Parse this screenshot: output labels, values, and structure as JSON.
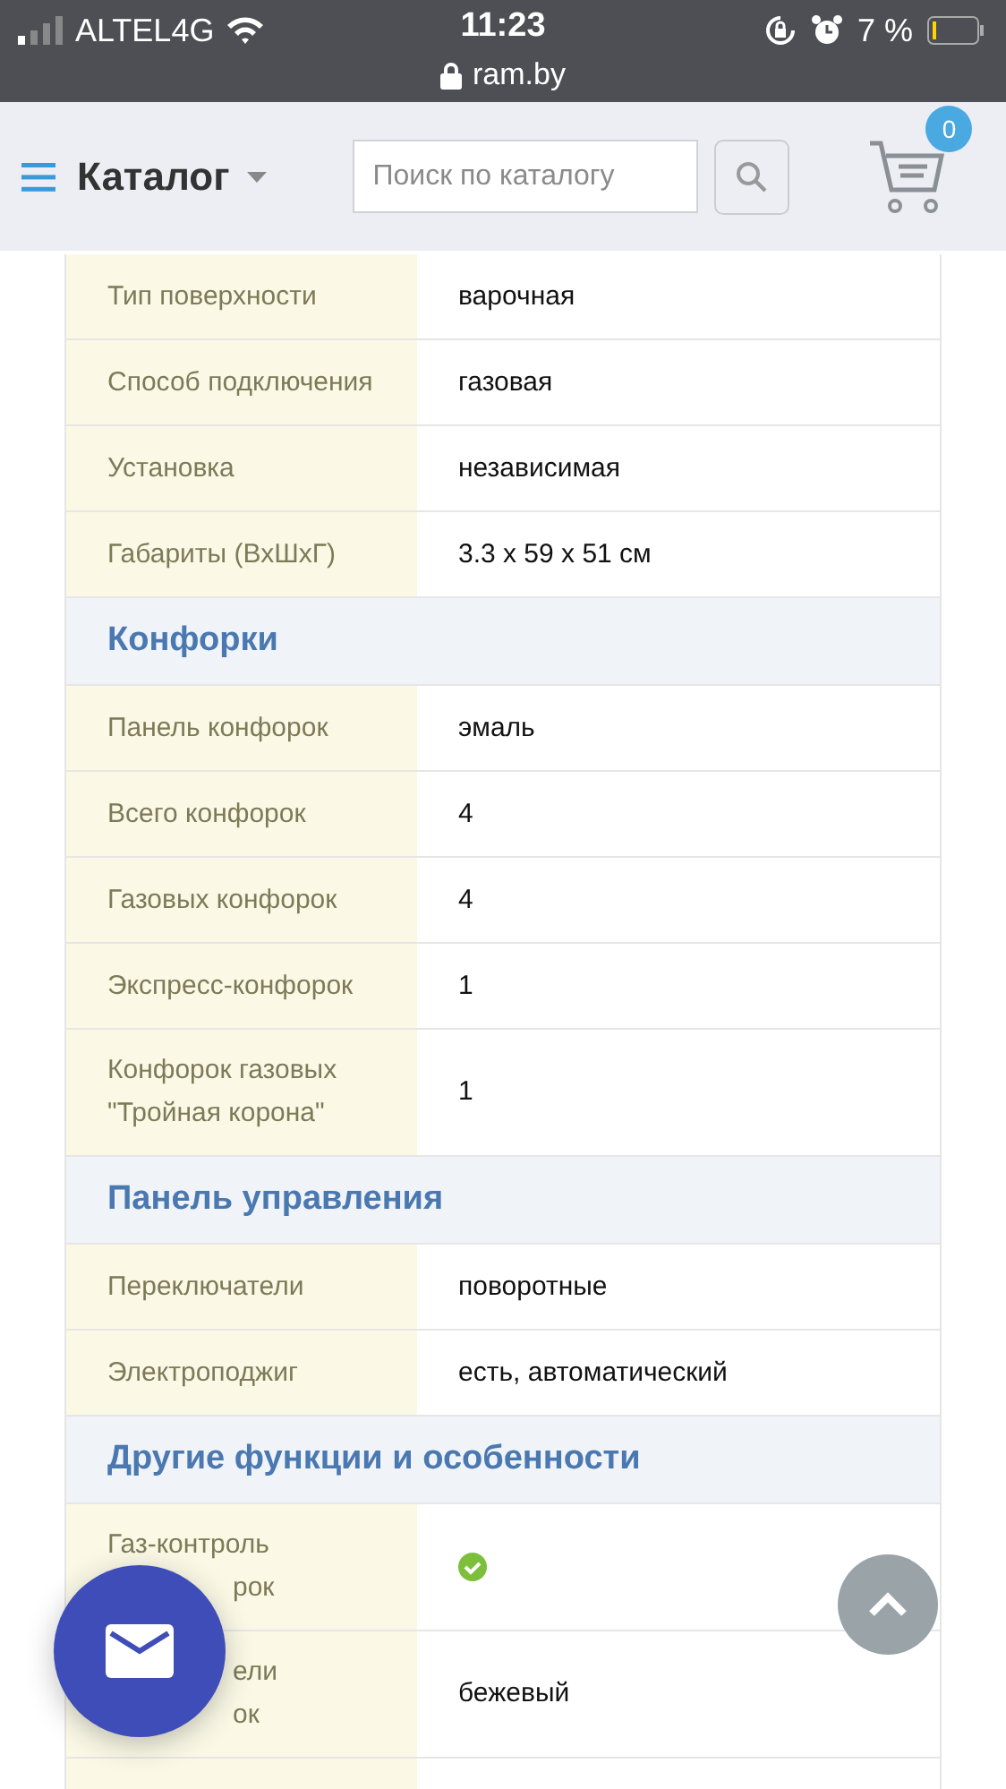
{
  "status_bar": {
    "carrier": "ALTEL4G",
    "time": "11:23",
    "url": "ram.by",
    "battery": "7 %"
  },
  "header": {
    "title": "Каталог",
    "search": {
      "placeholder": "Поиск по каталогу"
    },
    "cart": {
      "count": "0"
    }
  },
  "table": {
    "rows": [
      {
        "kind": "spec",
        "label": "Тип поверхности",
        "value": "варочная"
      },
      {
        "kind": "spec",
        "label": "Способ подключения",
        "value": "газовая"
      },
      {
        "kind": "spec",
        "label": "Установка",
        "value": "независимая"
      },
      {
        "kind": "spec",
        "label": "Габариты (ВхШхГ)",
        "value": "3.3 x 59 x 51 см"
      },
      {
        "kind": "section",
        "title": "Конфорки"
      },
      {
        "kind": "spec",
        "label": "Панель конфорок",
        "value": "эмаль"
      },
      {
        "kind": "spec",
        "label": "Всего конфорок",
        "value": "4"
      },
      {
        "kind": "spec",
        "label": "Газовых конфорок",
        "value": "4"
      },
      {
        "kind": "spec",
        "label": "Экспресс-конфорок",
        "value": "1"
      },
      {
        "kind": "spec",
        "label": "Конфорок газовых \"Тройная корона\"",
        "value": "1"
      },
      {
        "kind": "section",
        "title": "Панель управления"
      },
      {
        "kind": "spec",
        "label": "Переключатели",
        "value": "поворотные"
      },
      {
        "kind": "spec",
        "label": "Электроподжиг",
        "value": "есть, автоматический"
      },
      {
        "kind": "section",
        "title": "Другие функции и особенности"
      },
      {
        "kind": "spec",
        "label_lines": [
          {
            "text": "Газ-контроль",
            "covered": false
          },
          {
            "text": "рок",
            "covered": true
          }
        ],
        "checked": true
      },
      {
        "kind": "spec",
        "label_lines": [
          {
            "text": "ели",
            "covered": true
          },
          {
            "text": "ок",
            "covered": true
          }
        ],
        "value": "бежевый"
      }
    ]
  }
}
